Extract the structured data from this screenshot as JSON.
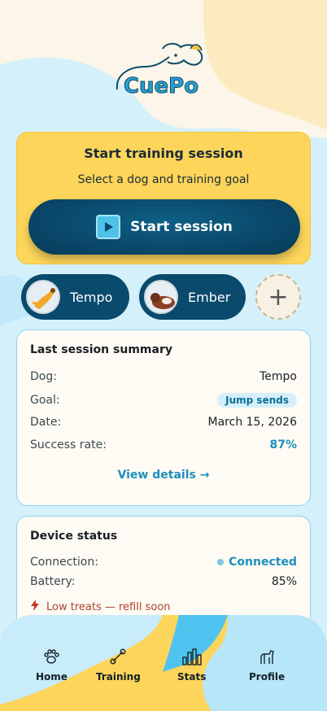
{
  "app": {
    "logo_text": "CuePo"
  },
  "start_card": {
    "title": "Start training session",
    "subtitle": "Select a dog and training goal",
    "button_label": "Start session"
  },
  "dogs": [
    {
      "name": "Tempo"
    },
    {
      "name": "Ember"
    }
  ],
  "add_dog_label": "+",
  "summary": {
    "title": "Last session summary",
    "rows": [
      {
        "label": "Dog:",
        "value": "Tempo"
      },
      {
        "label": "Goal:",
        "value": "Jump sends"
      },
      {
        "label": "Date:",
        "value": "March 15, 2026"
      },
      {
        "label": "Success rate:",
        "value": "87%"
      }
    ],
    "link": "View details →"
  },
  "device": {
    "title": "Device status",
    "connection_label": "Connection:",
    "connection_value": "Connected",
    "battery_label": "Battery:",
    "battery_value": "85%",
    "warning": "Low treats — refill soon"
  },
  "nav": {
    "items": [
      {
        "label": "Home",
        "icon": "paw-icon"
      },
      {
        "label": "Training",
        "icon": "bone-icon"
      },
      {
        "label": "Stats",
        "icon": "bar-chart-icon"
      },
      {
        "label": "Profile",
        "icon": "dog-profile-icon"
      }
    ]
  },
  "colors": {
    "accent": "#0a4a6c",
    "yellow": "#fcd55a",
    "light_blue": "#b6e6f8",
    "link": "#1f8fbd",
    "warning": "#b2412b"
  }
}
